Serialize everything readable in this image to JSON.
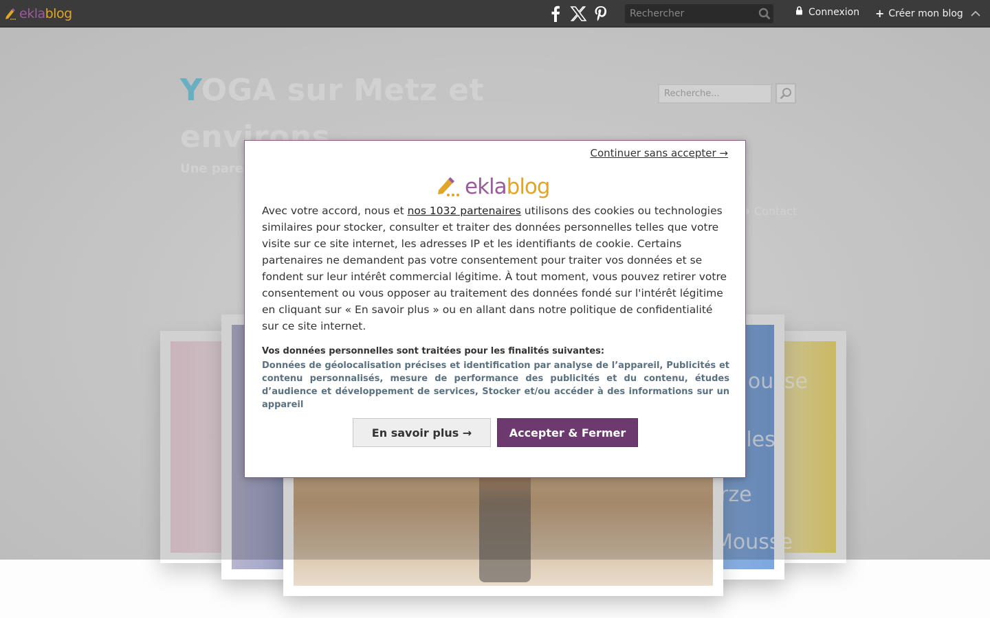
{
  "topbar": {
    "logo_ekla": "ekla",
    "logo_blog": "blog",
    "search_placeholder": "Rechercher",
    "login_label": "Connexion",
    "create_label": "Créer mon blog"
  },
  "blog": {
    "title_initial": "Y",
    "title_rest": "OGA sur Metz et environs",
    "subtitle": "Une paren",
    "search_placeholder": "Recherche...",
    "nav_contact": "Contact"
  },
  "consent": {
    "skip": "Continuer sans accepter →",
    "logo_ekla": "ekla",
    "logo_blog": "blog",
    "text_before_link": "Avec votre accord, nous et ",
    "partners_link": "nos 1032 partenaires",
    "text_after_link": " utilisons des cookies ou technologies similaires pour stocker, consulter et traiter des données personnelles telles que votre visite sur ce site internet, les adresses IP et les identifiants de cookie. Certains partenaires ne demandent pas votre consentement pour traiter vos données et se fondent sur leur intérêt commercial légitime. À tout moment, vous pouvez retirer votre consentement ou vous opposer au traitement des données fondé sur l'intérêt légitime en cliquant sur « En savoir plus » ou en allant dans notre politique de confidentialité sur ce site internet.",
    "purposes_title": "Vos données personnelles sont traitées pour les finalités suivantes:",
    "purposes": "Données de géolocalisation précises et identification par analyse de l’appareil, Publicités et contenu personnalisés, mesure de performance des publicités et du contenu, études d’audience et développement de services, Stocker et/ou accéder à des informations sur un appareil",
    "more_button": "En savoir plus →",
    "accept_button": "Accepter & Fermer"
  },
  "slides": [
    {
      "text": "Mousse"
    },
    {
      "text": "lles"
    },
    {
      "text": "rze"
    },
    {
      "text": "Mousse"
    }
  ],
  "colors": {
    "topbar": "#3b3b3b",
    "accent": "#6c3a6e",
    "logo_purple": "#9a5b9a",
    "logo_orange": "#e0a52a",
    "title_initial": "#7fd6ec"
  }
}
